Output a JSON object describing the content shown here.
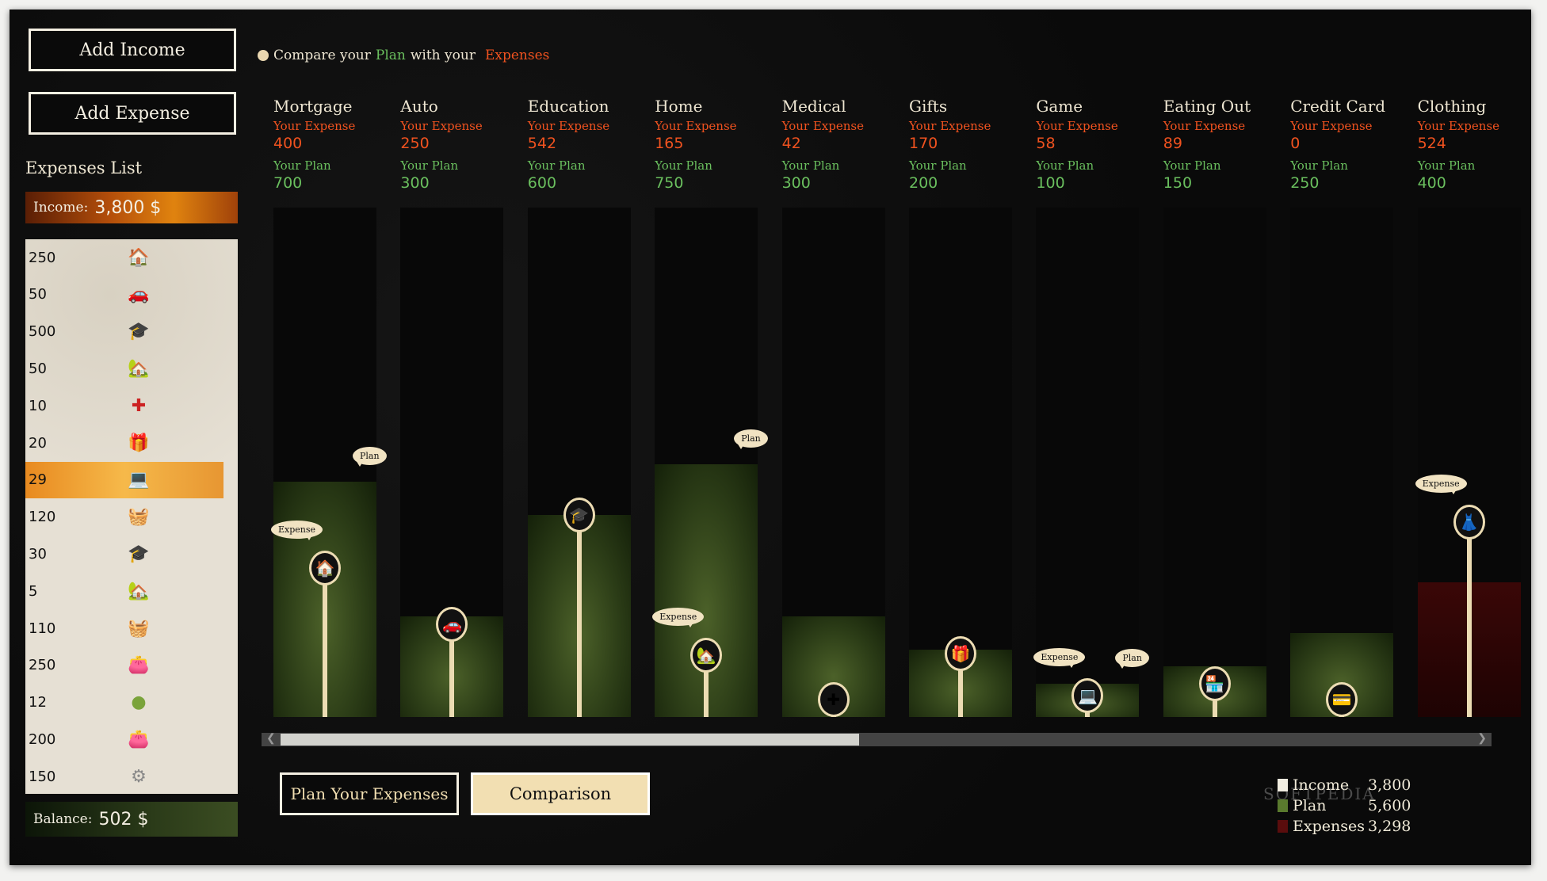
{
  "buttons": {
    "add_income": "Add Income",
    "add_expense": "Add Expense",
    "plan_expenses": "Plan Your Expenses",
    "comparison": "Comparison"
  },
  "compare_text": {
    "pre": "Compare your",
    "plan": "Plan",
    "mid": "with your",
    "expenses": "Expenses"
  },
  "sidebar": {
    "title": "Expenses List",
    "income_label": "Income:",
    "income_value": "3,800 $",
    "balance_label": "Balance:",
    "balance_value": "502 $",
    "items": [
      {
        "amount": "250",
        "icon": "mortgage-house-icon",
        "glyph": "🏠",
        "color": "#2e8b3a"
      },
      {
        "amount": "50",
        "icon": "car-icon",
        "glyph": "🚗",
        "color": "#222"
      },
      {
        "amount": "500",
        "icon": "graduation-cap-icon",
        "glyph": "🎓",
        "color": "#222"
      },
      {
        "amount": "50",
        "icon": "home-icon",
        "glyph": "🏡",
        "color": "#a86a3b"
      },
      {
        "amount": "10",
        "icon": "first-aid-kit-icon",
        "glyph": "✚",
        "color": "#c22"
      },
      {
        "amount": "20",
        "icon": "gift-icon",
        "glyph": "🎁",
        "color": "#d9a20e"
      },
      {
        "amount": "29",
        "icon": "laptop-icon",
        "glyph": "💻",
        "color": "#4a8ad8",
        "selected": true
      },
      {
        "amount": "120",
        "icon": "shopping-basket-icon",
        "glyph": "🧺",
        "color": "#7fc238"
      },
      {
        "amount": "30",
        "icon": "graduation-cap-icon",
        "glyph": "🎓",
        "color": "#222"
      },
      {
        "amount": "5",
        "icon": "home-icon",
        "glyph": "🏡",
        "color": "#a86a3b"
      },
      {
        "amount": "110",
        "icon": "shopping-basket-icon",
        "glyph": "🧺",
        "color": "#7fc238"
      },
      {
        "amount": "250",
        "icon": "wallet-icon",
        "glyph": "👛",
        "color": "#c97a1c"
      },
      {
        "amount": "12",
        "icon": "green-blob-icon",
        "glyph": "●",
        "color": "#7aa33a"
      },
      {
        "amount": "200",
        "icon": "wallet-icon",
        "glyph": "👛",
        "color": "#c97a1c"
      },
      {
        "amount": "150",
        "icon": "safe-coins-icon",
        "glyph": "⚙",
        "color": "#888"
      }
    ]
  },
  "labels": {
    "your_expense": "Your Expense",
    "your_plan": "Your Plan",
    "bubble_expense": "Expense",
    "bubble_plan": "Plan"
  },
  "chart_data": {
    "type": "bar",
    "title": "Compare your Plan with your Expenses",
    "categories": [
      "Mortgage",
      "Auto",
      "Education",
      "Home",
      "Medical",
      "Gifts",
      "Game",
      "Eating Out",
      "Credit Card",
      "Clothing"
    ],
    "series": [
      {
        "name": "Your Expense",
        "values": [
          400,
          250,
          542,
          165,
          42,
          170,
          58,
          89,
          0,
          524
        ],
        "color": "#f0521f"
      },
      {
        "name": "Your Plan",
        "values": [
          700,
          300,
          600,
          750,
          300,
          200,
          100,
          150,
          250,
          400
        ],
        "color": "#6abf5e"
      }
    ],
    "icons": [
      "mortgage-house-icon",
      "car-icon",
      "graduation-cap-icon",
      "home-icon",
      "first-aid-kit-icon",
      "gift-icon",
      "laptop-icon",
      "store-icon",
      "credit-card-icon",
      "clothing-icon"
    ],
    "glyphs": [
      "🏠",
      "🚗",
      "🎓",
      "🏡",
      "✚",
      "🎁",
      "💻",
      "🏪",
      "💳",
      "👗"
    ],
    "bubbles": {
      "expense": [
        0,
        3,
        6,
        9
      ],
      "plan": [
        0,
        3,
        6
      ]
    }
  },
  "scrollbar": {
    "position": 0.0,
    "visible_fraction": 0.47
  },
  "legend": [
    {
      "label": "Income",
      "value": "3,800",
      "color": "#f0ece0"
    },
    {
      "label": "Plan",
      "value": "5,600",
      "color": "#5a7a2e"
    },
    {
      "label": "Expenses",
      "value": "3,298",
      "color": "#5a0d0d"
    }
  ],
  "watermark": "SOFTPEDIA"
}
